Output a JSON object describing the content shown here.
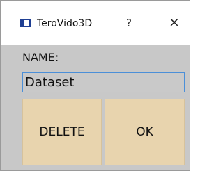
{
  "window": {
    "title": "TeroVido3D",
    "help_glyph": "?",
    "close_glyph": "×"
  },
  "form": {
    "name_label": "NAME:",
    "name_value": "Dataset"
  },
  "buttons": {
    "delete_label": "DELETE",
    "ok_label": "OK"
  },
  "colors": {
    "title_bar": "#ffffff",
    "window_body": "#c8c8c8",
    "button_fill": "#e8d4ae",
    "input_border": "#4b8fd8",
    "app_icon": "#1f3f93"
  },
  "icons": {
    "app": "app-window-icon",
    "help": "help-icon",
    "close": "close-icon"
  }
}
